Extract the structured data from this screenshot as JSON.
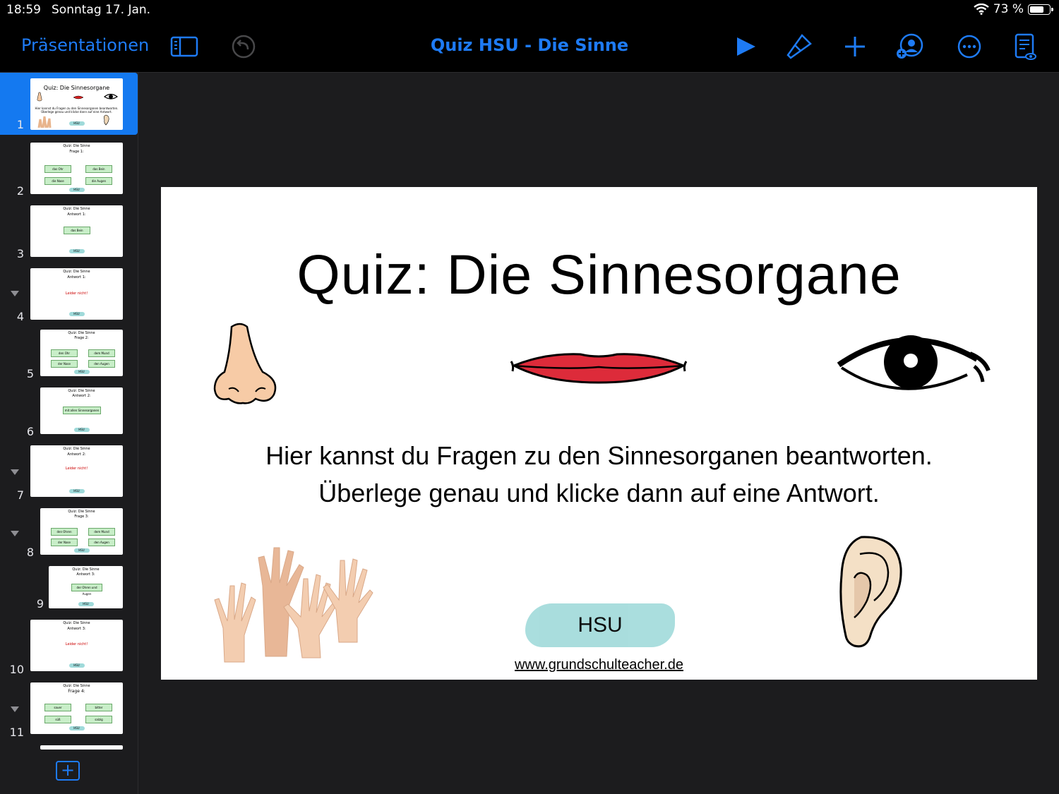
{
  "status": {
    "time": "18:59",
    "date": "Sonntag 17. Jan.",
    "battery": "73 %",
    "battery_level": 0.73
  },
  "toolbar": {
    "back_label": "Präsentationen",
    "title": "Quiz HSU - Die Sinne",
    "icons": [
      "sidebar-icon",
      "undo-icon",
      "play-icon",
      "format-brush-icon",
      "add-icon",
      "collaborate-icon",
      "more-icon",
      "presenter-notes-icon"
    ],
    "accent": "#1e7bf5"
  },
  "sidebar": {
    "slides": [
      {
        "number": "1",
        "title": "Quiz: Die Sinnesorgane",
        "selected": true
      },
      {
        "number": "2",
        "title": "Quiz: Die Sinne",
        "subtitle": "Frage 1:",
        "buttons": [
          "das Ohr",
          "das Bein",
          "die Nase",
          "die Augen"
        ]
      },
      {
        "number": "3",
        "title": "Quiz: Die Sinne",
        "subtitle": "Antwort 1:",
        "buttons": [
          "das Bein"
        ]
      },
      {
        "number": "4",
        "title": "Quiz: Die Sinne",
        "subtitle": "Antwort 1:",
        "note": "Leider nicht!",
        "collapsed": true
      },
      {
        "number": "5",
        "title": "Quiz: Die Sinne",
        "subtitle": "Frage 2:",
        "buttons": [
          "den Ohr",
          "dem Mund",
          "der Nase",
          "den Augen"
        ]
      },
      {
        "number": "6",
        "title": "Quiz: Die Sinne",
        "subtitle": "Antwort 2:",
        "buttons": [
          "mit allen Sinnesorganen"
        ]
      },
      {
        "number": "7",
        "title": "Quiz: Die Sinne",
        "subtitle": "Antwort 2:",
        "note": "Leider nicht!",
        "collapsed": true
      },
      {
        "number": "8",
        "title": "Quiz: Die Sinne",
        "subtitle": "Frage 3:",
        "buttons": [
          "den Ohren",
          "dem Mund",
          "der Nase",
          "den Augen"
        ],
        "collapsed": true
      },
      {
        "number": "9",
        "title": "Quiz: Die Sinne",
        "subtitle": "Antwort 3:",
        "buttons": [
          "der Ohren und Augen"
        ]
      },
      {
        "number": "10",
        "title": "Quiz: Die Sinne",
        "subtitle": "Antwort 3:",
        "note": "Leider nicht!"
      },
      {
        "number": "11",
        "title": "Quiz: Die Sinne",
        "subtitle": "Frage 4:",
        "buttons": [
          "sauer",
          "bitter",
          "süß",
          "salzig"
        ],
        "collapsed": true
      }
    ],
    "add_label": "+"
  },
  "slide": {
    "title": "Quiz: Die Sinnesorgane",
    "line1": "Hier kannst du Fragen zu den Sinnesorganen beantworten.",
    "line2": "Überlege genau und klicke dann auf eine Antwort.",
    "badge": "HSU",
    "url": "www.grundschulteacher.de",
    "images": [
      "nose-icon",
      "lips-icon",
      "eye-icon",
      "hands-icon",
      "ear-icon"
    ]
  }
}
